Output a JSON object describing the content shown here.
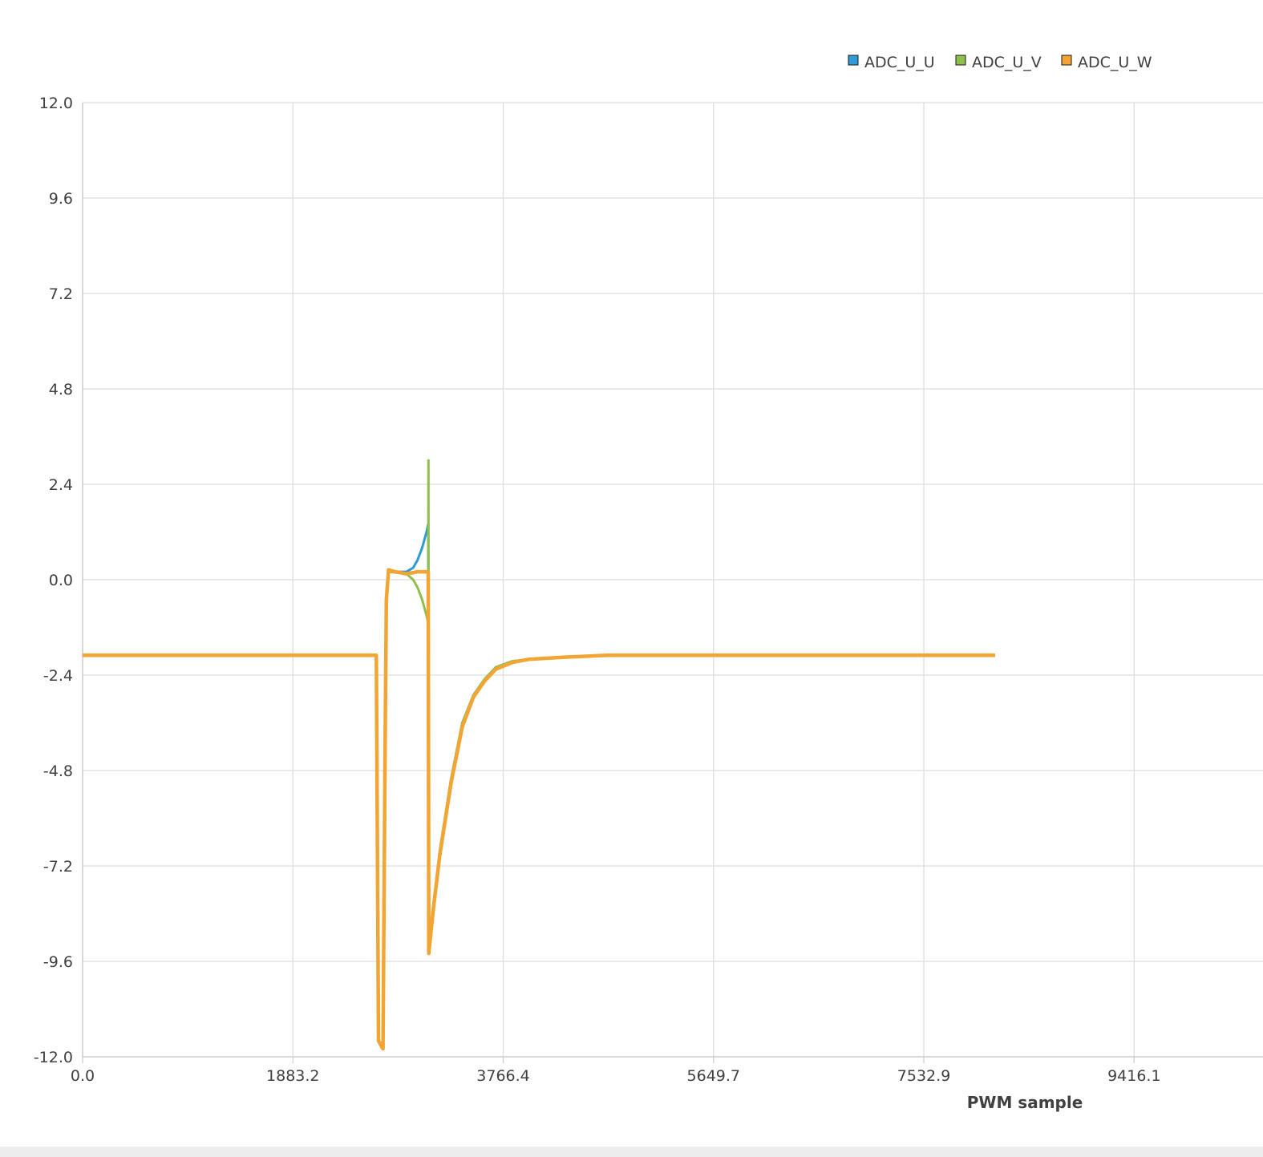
{
  "chart_data": {
    "type": "line",
    "title": "",
    "xlabel": "PWM sample",
    "ylabel": "",
    "xlim": [
      0,
      10570
    ],
    "ylim": [
      -12.0,
      12.0
    ],
    "x_ticks": [
      "0.0",
      "1883.2",
      "3766.4",
      "5649.7",
      "7532.9",
      "9416.1"
    ],
    "x_tick_values": [
      0,
      1883.2,
      3766.4,
      5649.7,
      7532.9,
      9416.1
    ],
    "y_ticks": [
      "12.0",
      "9.6",
      "7.2",
      "4.8",
      "2.4",
      "0.0",
      "-2.4",
      "-4.8",
      "-7.2",
      "-9.6",
      "-12.0"
    ],
    "y_tick_values": [
      12.0,
      9.6,
      7.2,
      4.8,
      2.4,
      0.0,
      -2.4,
      -4.8,
      -7.2,
      -9.6,
      -12.0
    ],
    "grid": true,
    "legend_position": "top-right",
    "series": [
      {
        "name": "ADC_U_U",
        "color": "#2f9bd6",
        "points": [
          [
            0,
            -1.9
          ],
          [
            2630,
            -1.9
          ],
          [
            2650,
            -11.6
          ],
          [
            2690,
            -11.7
          ],
          [
            2710,
            -3.8
          ],
          [
            2720,
            -0.5
          ],
          [
            2740,
            0.2
          ],
          [
            2900,
            0.2
          ],
          [
            2960,
            0.3
          ],
          [
            3000,
            0.5
          ],
          [
            3040,
            0.8
          ],
          [
            3080,
            1.2
          ],
          [
            3095,
            1.4
          ],
          [
            3100,
            -9.2
          ],
          [
            3140,
            -8.2
          ],
          [
            3200,
            -6.8
          ],
          [
            3300,
            -5.0
          ],
          [
            3400,
            -3.6
          ],
          [
            3500,
            -2.9
          ],
          [
            3600,
            -2.5
          ],
          [
            3700,
            -2.2
          ],
          [
            3850,
            -2.05
          ],
          [
            4000,
            -2.0
          ],
          [
            4300,
            -1.95
          ],
          [
            4700,
            -1.9
          ],
          [
            8170,
            -1.9
          ]
        ]
      },
      {
        "name": "ADC_U_V",
        "color": "#8fc04d",
        "points": [
          [
            0,
            -1.9
          ],
          [
            2630,
            -1.9
          ],
          [
            2650,
            -11.6
          ],
          [
            2690,
            -11.7
          ],
          [
            2710,
            -3.8
          ],
          [
            2720,
            -0.5
          ],
          [
            2740,
            0.2
          ],
          [
            2900,
            0.15
          ],
          [
            2960,
            0.0
          ],
          [
            3000,
            -0.2
          ],
          [
            3040,
            -0.5
          ],
          [
            3080,
            -0.9
          ],
          [
            3095,
            -1.1
          ],
          [
            3097,
            3.0
          ],
          [
            3100,
            -9.2
          ],
          [
            3140,
            -8.2
          ],
          [
            3200,
            -6.8
          ],
          [
            3300,
            -5.0
          ],
          [
            3400,
            -3.6
          ],
          [
            3500,
            -2.9
          ],
          [
            3600,
            -2.5
          ],
          [
            3700,
            -2.2
          ],
          [
            3850,
            -2.05
          ],
          [
            4000,
            -2.0
          ],
          [
            4300,
            -1.95
          ],
          [
            4700,
            -1.9
          ],
          [
            8170,
            -1.9
          ]
        ]
      },
      {
        "name": "ADC_U_W",
        "color": "#f2a532",
        "points": [
          [
            0,
            -1.9
          ],
          [
            2630,
            -1.9
          ],
          [
            2650,
            -11.6
          ],
          [
            2690,
            -11.8
          ],
          [
            2710,
            -3.8
          ],
          [
            2720,
            -0.5
          ],
          [
            2740,
            0.25
          ],
          [
            2800,
            0.2
          ],
          [
            2900,
            0.15
          ],
          [
            3000,
            0.2
          ],
          [
            3095,
            0.2
          ],
          [
            3100,
            -9.4
          ],
          [
            3140,
            -8.3
          ],
          [
            3200,
            -6.9
          ],
          [
            3300,
            -5.1
          ],
          [
            3400,
            -3.7
          ],
          [
            3500,
            -2.95
          ],
          [
            3600,
            -2.55
          ],
          [
            3700,
            -2.25
          ],
          [
            3850,
            -2.08
          ],
          [
            4000,
            -2.0
          ],
          [
            4300,
            -1.95
          ],
          [
            4700,
            -1.9
          ],
          [
            8170,
            -1.9
          ]
        ]
      }
    ]
  }
}
